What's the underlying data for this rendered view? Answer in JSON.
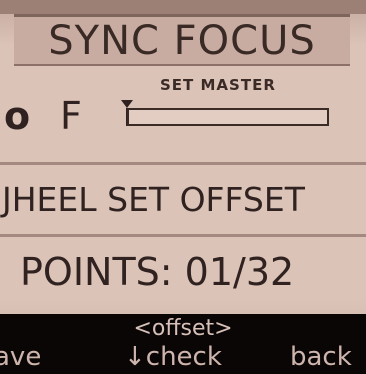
{
  "title": "SYNC FOCUS",
  "focus_row": {
    "label_o": "o",
    "label_f": "F",
    "set_master_label": "SET MASTER",
    "level": 0.0
  },
  "wheel_row": {
    "text": "JHEEL SET OFFSET"
  },
  "points_row": {
    "text": "POINTS: 01/32"
  },
  "softkeys": {
    "mode": "<offset>",
    "left": "ave",
    "center": "↓check",
    "right": "back"
  },
  "colors": {
    "screen_bg": "#dcc3b7",
    "title_bg": "#c9aca1",
    "text": "#2f2220",
    "softkey_bar": "#0b0606",
    "softkey_text": "#cdb5ad"
  }
}
